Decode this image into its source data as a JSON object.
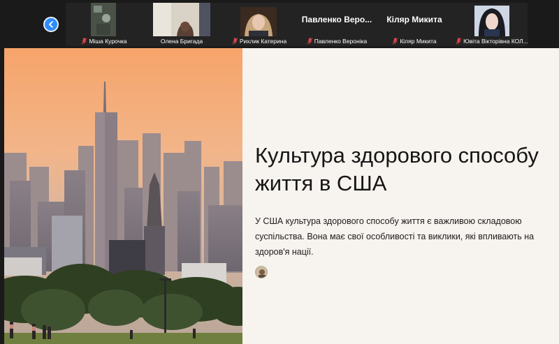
{
  "participants": [
    {
      "name": "Міша Курочка",
      "muted": true,
      "video": true
    },
    {
      "name": "Олена Бригада",
      "muted": false,
      "video": true
    },
    {
      "name": "Рихлик Катерина",
      "muted": true,
      "video": true
    },
    {
      "name": "Павленко Вероніка",
      "muted": true,
      "video": false,
      "cam_name": "Павленко Веро..."
    },
    {
      "name": "Кіляр Микита",
      "muted": true,
      "video": false,
      "cam_name": "Кіляр Микита"
    },
    {
      "name": "Ювіта Вікторівна КОЛ...",
      "muted": true,
      "video": true
    }
  ],
  "slide": {
    "title": "Культура здорового способу життя в США",
    "body": "У США культура здорового способу життя є важливою складовою суспільства. Вона має свої особливості та виклики, які впливають на здоров'я нації."
  },
  "icons": {
    "nav_prev": "chevron-left-icon",
    "mic_muted": "mic-muted-icon"
  },
  "colors": {
    "accent": "#2d8cff",
    "muted_mic": "#e0474c",
    "slide_bg": "#f7f3ee"
  }
}
